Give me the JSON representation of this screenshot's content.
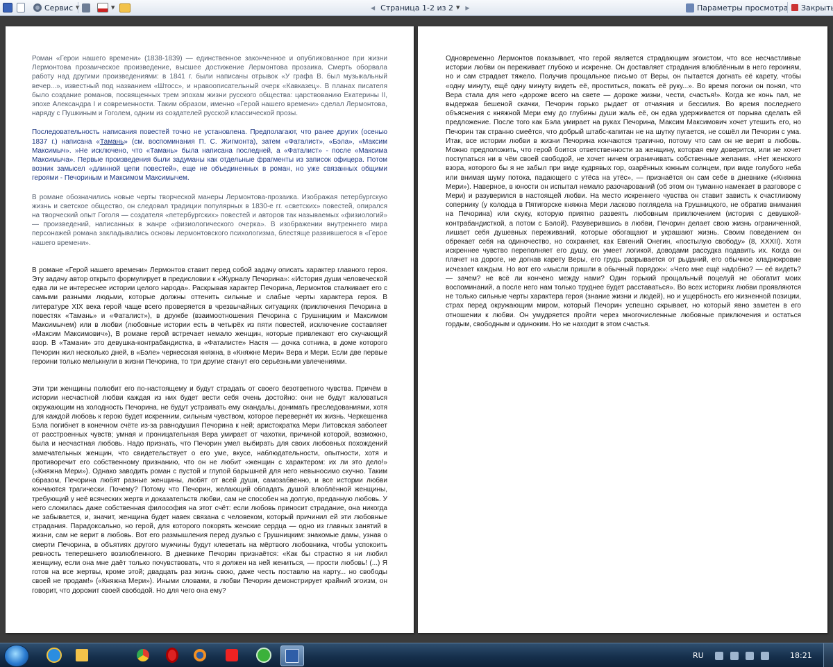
{
  "toolbar": {
    "service_label": "Сервис",
    "page_indicator": "Страница 1-2 из 2",
    "view_params_label": "Параметры просмотра",
    "close_label": "Закрыть",
    "icons": [
      "save-icon",
      "print-preview-icon",
      "service-icon",
      "research-icon",
      "spelling-icon",
      "folder-icon",
      "view-params-icon",
      "close-icon"
    ]
  },
  "page1": {
    "p1": "Роман «Герои нашего времени» (1838-1839) — единственное законченное и опубликованное при жизни Лермонтова прозаическое произведение, высшее достижение Лермонтова прозаика. Смерть оборвала работу над другими произведениями: в 1841 г. были написаны отрывок «У графа В. был музыкальный вечер...», известный под названием «Штосс», и нравоописательный очерк «Кавказец». В планах писателя было создание романов, посвященных трем эпохам жизни русского общества: царствованию Екатерины II, эпохе Александра I и современности. Таким образом, именно «Герой нашего времени» сделал Лермонтова, наряду с Пушкиным и Гоголем, одним из создателей русской классической прозы.",
    "p2_a": "Последовательность написания повестей точно не установлена. Предполагают, что ранее других (осенью 1837 г.) написана «",
    "p2_link": "Тамань",
    "p2_b": "» (см. воспоминания П. С. Жигмонта), затем «Фаталист», «Бэла», «Максим Максимыч». »Не исключено, что «Тамань» была написана последней, а «Фаталист» - после «Максима Максимыча». Первые произведения были задуманы как отдельные фрагменты из записок офицера. Потом возник замысел «длинной цепи повестей», еще не объединенных в роман, но уже связанных общими героями - Печориным и Максимом Максимычем.",
    "p3": "В романе обозначились новые черты творческой манеры Лермонтова-прозаика. Изображая петербургскую жизнь и светское общество, он следовал традиции популярных в 1830-е гг. «светских» повестей, опирался на творческий опыт Гоголя — создателя «петербургских» повестей и авторов так называемых «физиологий» — произведений, написанных в жанре «физиологического очерка». В изображении внутреннего мира персонажей романа закладывались основы лермонтовского психологизма, блестяще развившегося в «Герое нашего времени».",
    "p4": " В романе «Герой нашего времени» Лермонтов ставит перед собой задачу описать характер главного героя. Эту задачу автор открыто формулирует в предисловии к «Журналу Печорина»: «История души человеческой едва ли не интереснее истории целого народа». Раскрывая характер Печорина, Лермонтов сталкивает его с самыми разными людьми, которые должны оттенить сильные и слабые черты характера героя. В литературе XIX века герой чаще всего проверяется в чрезвычайных ситуациях (приключения Печорина в повестях «Тамань» и «Фаталист»), в дружбе (взаимоотношения Печорина с Грушницким и Максимом Максимычем) или в любви (любовные истории есть в четырёх из пяти повестей, исключение составляет «Максим Максимович»), В романе герой встречает немало женщин, которые привлекают его скучающий взор. В «Тамани» это девушка-контрабандистка, в «Фаталисте» Настя — дочка сотника, в доме которого Печорин жил несколько дней, в «Бэле» черкесская княжна, в «Княжне Мери» Вера и Мери. Если две первые героини только мелькнули в жизни Печорина, то три другие станут его серьёзными увлечениями.",
    "p5": " Эти три женщины полюбит его по-настоящему и будут страдать от своего безответного чувства. Причём в истории несчастной любви каждая из них будет вести себя очень достойно: они не будут жаловаться окружающим на холодность Печорина, не будут устраивать ему скандалы, донимать преследованиями, хотя для каждой любовь к герою будет искренним, сильным чувством, которое перевернёт их жизнь. Черкешенка Бэла погибнет в конечном счёте из-за равнодушия Печорина к ней; аристократка Мери Литовская заболеет от расстроенных чувств; умная и проницательная Вера умирает от чахотки, причиной которой, возможно, была и несчастная любовь. Надо признать, что Печорин умел выбирать для своих любовных похождений замечательных женщин, что свидетельствует о его уме, вкусе, наблюдательности, опытности, хотя и противоречит его собственному признанию, что он не любит «женщин с характером: их ли это дело!» («Княжна Мери»). Однако заводить роман с пустой и глупой барышней для него невыносимо скучно. Таким образом, Печорина любят разные женщины, любят от всей души, самозабвенно, и все истории любви кончаются трагически. Почему? Потому что Печорин, желающий обладать душой влюблённой женщины, требующий у неё всяческих жертв и доказательств любви, сам не способен на долгую, преданную любовь. У него сложилась даже собственная философия на этот счёт: если любовь приносит страдание, она никогда не забывается, и, значит, женщина будет навек связана с человеком, который причинил ей эти любовные страдания. Парадоксально, но герой, для которого покорять женские сердца — одно из главных занятий в жизни, сам не верит в любовь. Вот его размышления перед дуэлью с Грушницким: знакомые дамы, узнав о смерти Печорина, в объятиях другого мужчины будут клеветать на мёртвого любовника, чтобы успокоить ревность теперешнего возлюбленного. В дневнике Печорин признаётся: «Как бы страстно я ни любил женщину, если она мне даёт только почувствовать, что я должен на ней жениться, — прости любовь! (...) Я готов на все жертвы, кроме этой; двадцать раз жизнь свою, даже честь поставлю на карту... но свободы своей не продам!» («Княжна Мери»). Иными словами, в любви Печорин демонстрирует крайний эгоизм, он говорит, что дорожит своей свободой. Но для чего она ему?"
  },
  "page2": {
    "p1": "Одновременно Лермонтов показывает, что герой является страдающим эгоистом, что все несчастливые истории любви он переживает глубоко и искренне. Он доставляет страдания влюблённым в него героиням, но и сам страдает тяжело. Получив прощальное письмо от Веры, он пытается догнать её карету, чтобы «одну минуту, ещё одну минуту видеть её, проститься, пожать её руку...». Во время погони он понял, что Вера стала для него «дороже всего на свете — дороже жизни, чести, счастья!». Когда же конь пал, не выдержав бешеной скачки, Печорин горько рыдает от отчаяния и бессилия. Во время последнего объяснения с княжной Мери ему до глубины души жаль её, он едва удерживается от порыва сделать ей предложение. После того как Бэла умирает на руках Печорина, Максим Максимович хочет утешить его, но Печорин так странно смеётся, что добрый штабс-капитан не на шутку пугается, не сошёл ли Печорин с ума. Итак, все истории любви в жизни Печорина кончаются трагично, потому что сам он не верит в любовь. Можно предположить, что герой боится ответственности за женщину, которая ему доверится, или не хочет поступаться ни в чём своей свободой, не хочет ничем ограничивать собственные желания. «Нет женского взора, которого бы я не забыл при виде кудрявых гор, озарённых южным солнцем, при виде голубого неба или внимая шуму потока, падающего с утёса на утёс», — признаётся он сам себе в дневнике («Княжна Мери»). Наверное, в юности он испытал немало разочарований (об этом он туманно намекает в разговоре с Мери) и разуверился в настоящей любви. На место искреннего чувства он ставит зависть к счастливому сопернику (у колодца в Пятигорске княжна Мери ласково поглядела на Грушницкого, не обратив внимания на Печорина) или скуку, которую приятно развеять любовным приключением (история с девушкой-контрабандисткой, а потом с Бэлой). Разуверившись в любви, Печорин делает свою жизнь ограниченной, лишает себя душевных переживаний, которые обогащают и украшают жизнь. Своим поведением он обрекает себя на одиночество, но сохраняет, как Евгений Онегин, «постылую свободу» (8, XXXII). Хотя искреннее чувство переполняет его душу, он умеет логикой, доводами рассудка подавить их. Когда он плачет на дороге, не догнав карету Веры, его грудь разрывается от рыданий, его обычное хладнокровие исчезает каждым. Но вот его «мысли пришли в обычный порядок»: «Чего мне ещё надобно? — её видеть? — зачем? не всё ли кончено между нами? Один горький прощальный поцелуй не обогатит моих воспоминаний, а после него нам только труднее будет расставаться». Во всех историях любви проявляются не только сильные черты характера героя (знание жизни и людей), но и ущербность его жизненной позиции, страх перед окружающим миром, который Печорин успешно скрывает, но который явно заметен в его отношении к любви. Он умудряется пройти через многочисленные любовные приключения и остаться гордым, свободным и одиноким. Но не находит в этом счастья."
  },
  "taskbar": {
    "language": "RU",
    "time": "18:21",
    "icons": [
      "start-button",
      "ie-icon",
      "explorer-icon",
      "chrome-icon",
      "opera-icon",
      "firefox-icon",
      "yandex-icon",
      "green-app-icon",
      "word-icon"
    ]
  }
}
